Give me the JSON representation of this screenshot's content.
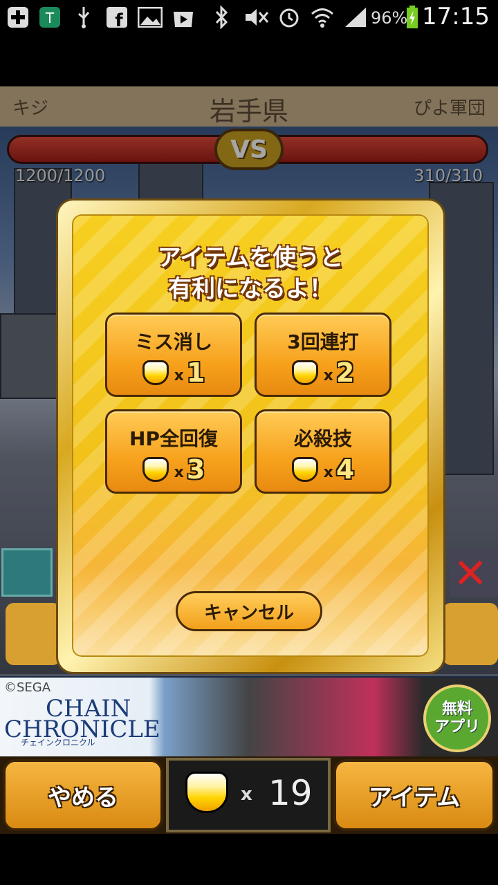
{
  "status_bar": {
    "battery_percent": "96%",
    "time": "17:15",
    "icons": [
      "plus-icon",
      "shield-app-icon",
      "usb-icon",
      "facebook-icon",
      "image-icon",
      "play-store-icon",
      "bluetooth-icon",
      "mute-icon",
      "alarm-icon",
      "wifi-icon",
      "signal-icon",
      "battery-charging-icon"
    ]
  },
  "header": {
    "left_name": "キジ",
    "prefecture": "岩手県",
    "right_name": "ぴよ軍団"
  },
  "battle": {
    "vs_label": "VS",
    "left_hp": "1200/1200",
    "right_hp": "310/310"
  },
  "modal": {
    "title_line1": "アイテムを使うと",
    "title_line2": "有利になるよ！",
    "items": [
      {
        "name": "ミス消し",
        "x": "x",
        "cost": "1"
      },
      {
        "name": "3回連打",
        "x": "x",
        "cost": "2"
      },
      {
        "name": "HP全回復",
        "x": "x",
        "cost": "3"
      },
      {
        "name": "必殺技",
        "x": "x",
        "cost": "4"
      }
    ],
    "cancel_label": "キャンセル"
  },
  "ad": {
    "copyright": "©SEGA",
    "title_line1": "CHAIN",
    "title_line2": "CHRONICLE",
    "subtitle": "チェインクロニクル",
    "badge_line1": "無料",
    "badge_line2": "アプリ"
  },
  "bottom_bar": {
    "quit_label": "やめる",
    "coin_x": "x",
    "coin_count": "19",
    "item_label": "アイテム"
  }
}
